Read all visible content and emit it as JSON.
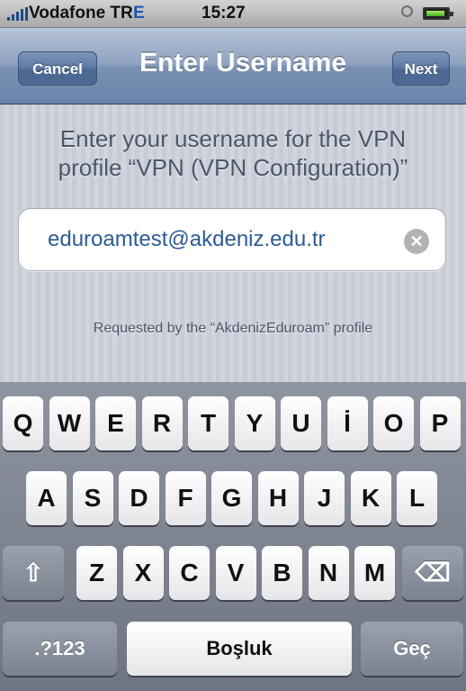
{
  "status_bar": {
    "carrier": "Vodafone TR",
    "network": "E",
    "time": "15:27",
    "battery_level": 0.85
  },
  "nav": {
    "cancel_label": "Cancel",
    "title": "Enter Username",
    "next_label": "Next"
  },
  "main": {
    "prompt_line1": "Enter your username for the VPN",
    "prompt_line2": "profile “VPN (VPN Configuration)”",
    "username_value": "eduroamtest@akdeniz.edu.tr",
    "requested_by": "Requested by the “AkdenizEduroam” profile"
  },
  "keyboard": {
    "row1": [
      "Q",
      "W",
      "E",
      "R",
      "T",
      "Y",
      "U",
      "İ",
      "O",
      "P"
    ],
    "row2": [
      "A",
      "S",
      "D",
      "F",
      "G",
      "H",
      "J",
      "K",
      "L"
    ],
    "row3": [
      "Z",
      "X",
      "C",
      "V",
      "B",
      "N",
      "M"
    ],
    "numbers_label": ".?123",
    "space_label": "Boşluk",
    "return_label": "Geç",
    "shift_icon": "shift-arrow-icon",
    "delete_icon": "backspace-icon"
  },
  "colors": {
    "nav_bar": "#7a91b2",
    "field_text": "#2d5b95",
    "network_indicator": "#1d56b4"
  }
}
